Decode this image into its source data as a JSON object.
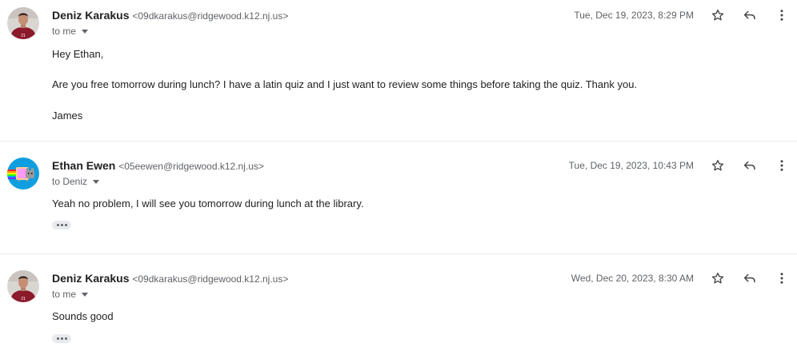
{
  "messages": [
    {
      "sender_name": "Deniz Karakus",
      "sender_email": "<09dkarakus@ridgewood.k12.nj.us>",
      "recipient": "to me",
      "timestamp": "Tue, Dec 19, 2023, 8:29 PM",
      "avatar_icon": "soccer-player-avatar",
      "body": [
        "Hey Ethan,",
        "Are you free tomorrow during lunch?  I have a latin quiz and I just want to review some things before taking the quiz.  Thank you.",
        "James"
      ]
    },
    {
      "sender_name": "Ethan Ewen",
      "sender_email": "<05eewen@ridgewood.k12.nj.us>",
      "recipient": "to Deniz",
      "timestamp": "Tue, Dec 19, 2023, 10:43 PM",
      "avatar_icon": "nyan-cat-avatar",
      "body": [
        "Yeah no problem, I will see you tomorrow during lunch at the library."
      ]
    },
    {
      "sender_name": "Deniz Karakus",
      "sender_email": "<09dkarakus@ridgewood.k12.nj.us>",
      "recipient": "to me",
      "timestamp": "Wed, Dec 20, 2023, 8:30 AM",
      "avatar_icon": "soccer-player-avatar",
      "body": [
        "Sounds good"
      ]
    }
  ],
  "icons": {
    "star": "star-icon",
    "reply": "reply-icon",
    "more": "more-vert-icon",
    "trimmed": "show-trimmed-content-icon"
  },
  "colors": {
    "text_primary": "#202124",
    "text_secondary": "#5f6368",
    "divider": "#e8eaed",
    "jersey_red": "#8b1a2b"
  }
}
